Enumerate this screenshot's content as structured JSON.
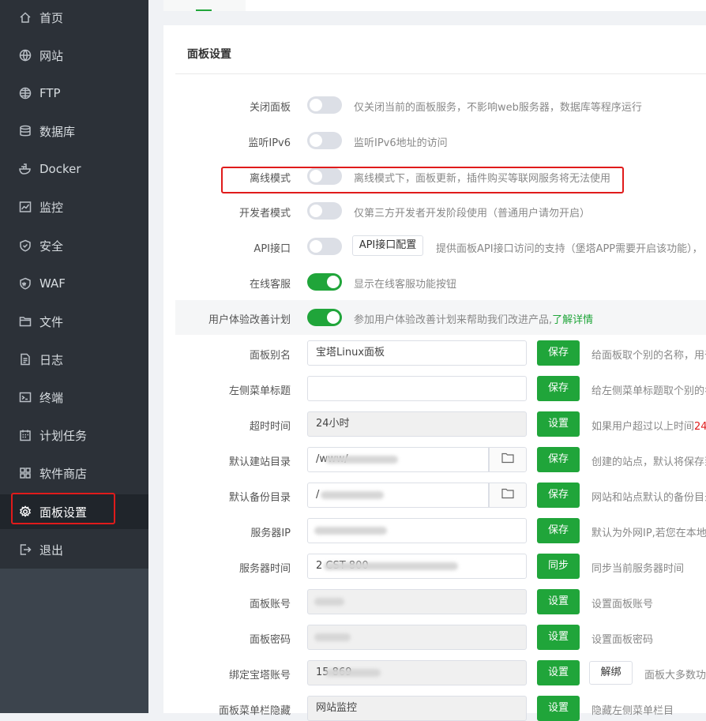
{
  "sidebar": {
    "items": [
      {
        "label": "首页",
        "icon": "home-icon"
      },
      {
        "label": "网站",
        "icon": "globe-icon"
      },
      {
        "label": "FTP",
        "icon": "globe-icon"
      },
      {
        "label": "数据库",
        "icon": "database-icon"
      },
      {
        "label": "Docker",
        "icon": "docker-icon"
      },
      {
        "label": "监控",
        "icon": "monitor-icon"
      },
      {
        "label": "安全",
        "icon": "shield-icon"
      },
      {
        "label": "WAF",
        "icon": "waf-icon"
      },
      {
        "label": "文件",
        "icon": "folder-icon"
      },
      {
        "label": "日志",
        "icon": "log-icon"
      },
      {
        "label": "终端",
        "icon": "terminal-icon"
      },
      {
        "label": "计划任务",
        "icon": "calendar-icon"
      },
      {
        "label": "软件商店",
        "icon": "apps-icon"
      },
      {
        "label": "面板设置",
        "icon": "gear-icon",
        "active": true
      },
      {
        "label": "退出",
        "icon": "logout-icon"
      }
    ]
  },
  "panel": {
    "title": "面板设置"
  },
  "toggles": [
    {
      "label": "关闭面板",
      "on": false,
      "desc": "仅关闭当前的面板服务，不影响web服务器，数据库等程序运行"
    },
    {
      "label": "监听IPv6",
      "on": false,
      "desc": "监听IPv6地址的访问"
    },
    {
      "label": "离线模式",
      "on": false,
      "desc": "离线模式下，面板更新，插件购买等联网服务将无法使用"
    },
    {
      "label": "开发者模式",
      "on": false,
      "desc": "仅第三方开发者开发阶段使用（普通用户请勿开启）"
    },
    {
      "label": "API接口",
      "on": false,
      "button": "API接口配置",
      "desc": "提供面板API接口访问的支持（堡塔APP需要开启该功能），"
    },
    {
      "label": "在线客服",
      "on": true,
      "desc": "显示在线客服功能按钮"
    },
    {
      "label": "用户体验改善计划",
      "on": true,
      "desc": "参加用户体验改善计划来帮助我们改进产品,",
      "link": "了解详情"
    }
  ],
  "fields": [
    {
      "label": "面板别名",
      "value": "宝塔Linux面板",
      "button": "保存",
      "desc": "给面板取个别的名称，用于"
    },
    {
      "label": "左侧菜单标题",
      "value": "",
      "button": "保存",
      "desc": "给左侧菜单标题取个别的名"
    },
    {
      "label": "超时时间",
      "value": "24小时",
      "button": "设置",
      "desc": "如果用户超过以上时间",
      "desc_red": "24"
    },
    {
      "label": "默认建站目录",
      "value": "/www/",
      "button": "保存",
      "desc": "创建的站点，默认将保存到"
    },
    {
      "label": "默认备份目录",
      "value": "/",
      "button": "保存",
      "desc": "网站和站点默认的备份目录"
    },
    {
      "label": "服务器IP",
      "value": "",
      "button": "保存",
      "desc": "默认为外网IP,若您在本地虚"
    },
    {
      "label": "服务器时间",
      "value": "2                    CST        800",
      "button": "同步",
      "desc": "同步当前服务器时间"
    },
    {
      "label": "面板账号",
      "value": "",
      "button": "设置",
      "desc": "设置面板账号"
    },
    {
      "label": "面板密码",
      "value": "",
      "button": "设置",
      "desc": "设置面板密码"
    },
    {
      "label": "绑定宝塔账号",
      "value": "15      869",
      "button": "设置",
      "extra_button": "解绑",
      "desc": "面板大多数功能"
    },
    {
      "label": "面板菜单栏隐藏",
      "value": "网站监控",
      "button": "设置",
      "desc": "隐藏左侧菜单栏目"
    }
  ],
  "colors": {
    "accent": "#20a53a",
    "highlight": "#e01b1b",
    "sidebar": "#2c3138"
  }
}
